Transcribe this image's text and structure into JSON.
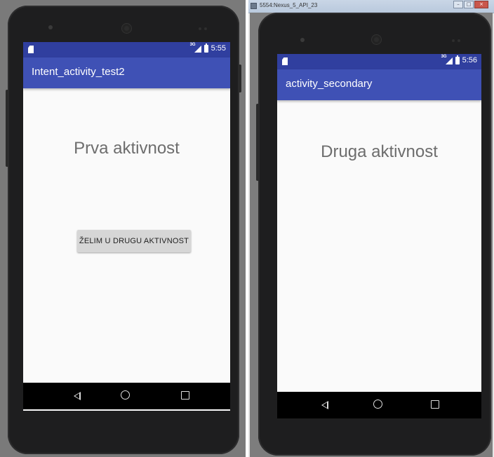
{
  "left_device": {
    "status_bar": {
      "network_label": "3G",
      "time": "5:55"
    },
    "app_bar": {
      "title": "Intent_activity_test2"
    },
    "content": {
      "heading": "Prva aktivnost",
      "button_label": "ŽELIM U DRUGU AKTIVNOST"
    },
    "nav": [
      "back-icon",
      "home-icon",
      "recents-icon"
    ]
  },
  "right_window": {
    "title": "5554:Nexus_5_API_23",
    "controls": [
      "minimize",
      "maximize",
      "close"
    ]
  },
  "right_device": {
    "status_bar": {
      "network_label": "3G",
      "time": "5:56"
    },
    "app_bar": {
      "title": "activity_secondary"
    },
    "content": {
      "heading": "Druga aktivnost"
    },
    "nav": [
      "back-icon",
      "home-icon",
      "recents-icon"
    ]
  },
  "colors": {
    "status_bar": "#303f9f",
    "app_bar": "#3f51b5",
    "screen_bg": "#fafafa",
    "button_bg": "#d6d6d6",
    "heading_text": "#6d6d6d"
  }
}
